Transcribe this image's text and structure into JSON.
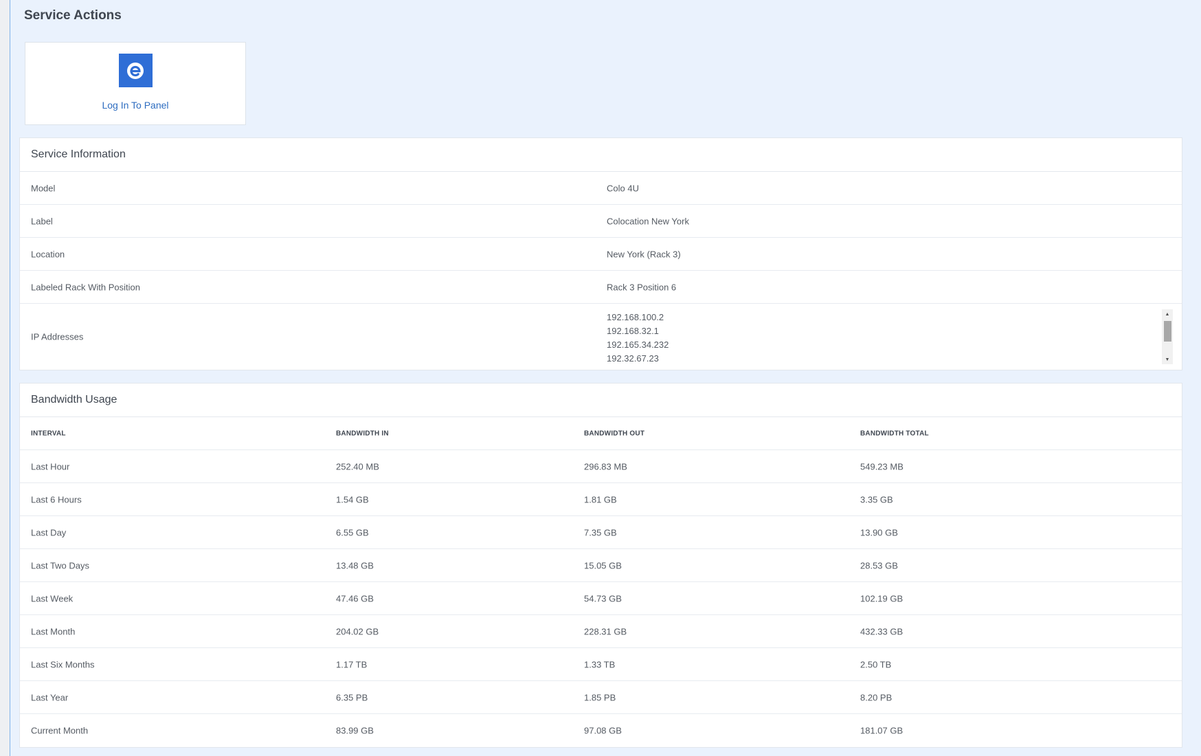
{
  "service_actions": {
    "title": "Service Actions",
    "tiles": [
      {
        "label": "Log In To Panel",
        "icon": "panel-logo-icon",
        "color": "#2f6ed6"
      }
    ]
  },
  "service_information": {
    "title": "Service Information",
    "rows": [
      {
        "key": "Model",
        "value": "Colo 4U"
      },
      {
        "key": "Label",
        "value": "Colocation New York"
      },
      {
        "key": "Location",
        "value": "New York (Rack 3)"
      },
      {
        "key": "Labeled Rack With Position",
        "value": "Rack 3 Position 6"
      }
    ],
    "ip": {
      "key": "IP Addresses",
      "addresses": [
        "192.168.100.2",
        "192.168.32.1",
        "192.165.34.232",
        "192.32.67.23"
      ]
    }
  },
  "bandwidth_usage": {
    "title": "Bandwidth Usage",
    "headers": [
      "INTERVAL",
      "BANDWIDTH IN",
      "BANDWIDTH OUT",
      "BANDWIDTH TOTAL"
    ],
    "rows": [
      [
        "Last Hour",
        "252.40 MB",
        "296.83 MB",
        "549.23 MB"
      ],
      [
        "Last 6 Hours",
        "1.54 GB",
        "1.81 GB",
        "3.35 GB"
      ],
      [
        "Last Day",
        "6.55 GB",
        "7.35 GB",
        "13.90 GB"
      ],
      [
        "Last Two Days",
        "13.48 GB",
        "15.05 GB",
        "28.53 GB"
      ],
      [
        "Last Week",
        "47.46 GB",
        "54.73 GB",
        "102.19 GB"
      ],
      [
        "Last Month",
        "204.02 GB",
        "228.31 GB",
        "432.33 GB"
      ],
      [
        "Last Six Months",
        "1.17 TB",
        "1.33 TB",
        "2.50 TB"
      ],
      [
        "Last Year",
        "6.35 PB",
        "1.85 PB",
        "8.20 PB"
      ],
      [
        "Current Month",
        "83.99 GB",
        "97.08 GB",
        "181.07 GB"
      ]
    ]
  }
}
